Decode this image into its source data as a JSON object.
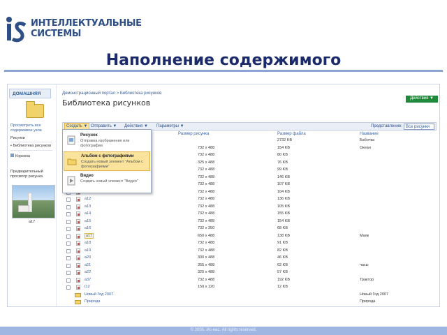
{
  "slide": {
    "logo_mark": "iS",
    "logo_line1": "ИНТЕЛЛЕКТУАЛЬНЫЕ",
    "logo_line2": "СИСТЕМЫ",
    "title": "Наполнение содержимого",
    "footer": "© 2005. Ис-нас. All rights reserved."
  },
  "nav": {
    "home_tab": "ДОМАШНЯЯ",
    "view_all": "Просмотреть все содержимое узла",
    "pictures_head": "Рисунки",
    "library_link": "• Библиотека рисунков",
    "recycle": "Корзина",
    "preview_label": "Предварительный просмотр рисунка",
    "preview_caption": "a17"
  },
  "main": {
    "breadcrumb": "Демонстрационный портал > Библиотека рисунков",
    "title": "Библиотека рисунков",
    "actions_button": "Действия ▼",
    "toolbar": {
      "create": "Создать ▼",
      "send": "Отправить ▼",
      "actions": "Действия ▼",
      "settings": "Параметры ▼",
      "view_label": "Представление:",
      "view_value": "Все рисунки"
    },
    "columns": {
      "size": "Размер рисунка",
      "filesize": "Размер файла",
      "name": "Название"
    }
  },
  "menu": {
    "items": [
      {
        "title": "Рисунок",
        "desc": "Отправка изображения или фотографии"
      },
      {
        "title": "Альбом с фотографиями",
        "desc": "Создать новый элемент \"Альбом с фотографиями\""
      },
      {
        "title": "Видео",
        "desc": "Создать новый элемент \"Видео\""
      }
    ]
  },
  "rows": [
    {
      "file": "",
      "size": "",
      "filesize": "2732 KB",
      "title": "Бабочка",
      "kind": "file"
    },
    {
      "file": "",
      "size": "732 x 488",
      "filesize": "154 KB",
      "title": "Океан",
      "kind": "file"
    },
    {
      "file": "",
      "size": "732 x 488",
      "filesize": "80 KB",
      "title": "",
      "kind": "file"
    },
    {
      "file": "",
      "size": "325 x 488",
      "filesize": "76 KB",
      "title": "",
      "kind": "file"
    },
    {
      "file": "",
      "size": "732 x 488",
      "filesize": "99 KB",
      "title": "",
      "kind": "file"
    },
    {
      "file": "",
      "size": "732 x 488",
      "filesize": "146 KB",
      "title": "",
      "kind": "file"
    },
    {
      "file": "",
      "size": "732 x 488",
      "filesize": "107 KB",
      "title": "",
      "kind": "file"
    },
    {
      "file": "",
      "size": "732 x 488",
      "filesize": "104 KB",
      "title": "",
      "kind": "file"
    },
    {
      "file": "a12",
      "size": "732 x 488",
      "filesize": "136 KB",
      "title": "",
      "kind": "file"
    },
    {
      "file": "a13",
      "size": "732 x 488",
      "filesize": "105 KB",
      "title": "",
      "kind": "file"
    },
    {
      "file": "a14",
      "size": "732 x 488",
      "filesize": "155 KB",
      "title": "",
      "kind": "file"
    },
    {
      "file": "a15",
      "size": "732 x 488",
      "filesize": "154 KB",
      "title": "",
      "kind": "file"
    },
    {
      "file": "a16",
      "size": "732 x 350",
      "filesize": "68 KB",
      "title": "",
      "kind": "file"
    },
    {
      "file": "a17",
      "size": "650 x 488",
      "filesize": "138 KB",
      "title": "Маяк",
      "kind": "file",
      "selected": true
    },
    {
      "file": "a18",
      "size": "732 x 488",
      "filesize": "91 KB",
      "title": "",
      "kind": "file"
    },
    {
      "file": "a19",
      "size": "732 x 488",
      "filesize": "82 KB",
      "title": "",
      "kind": "file"
    },
    {
      "file": "a20",
      "size": "300 x 488",
      "filesize": "46 KB",
      "title": "",
      "kind": "file"
    },
    {
      "file": "a21",
      "size": "355 x 488",
      "filesize": "62 KB",
      "title": "часы",
      "kind": "file"
    },
    {
      "file": "a22",
      "size": "325 x 488",
      "filesize": "57 KB",
      "title": "",
      "kind": "file"
    },
    {
      "file": "a37",
      "size": "732 x 488",
      "filesize": "192 KB",
      "title": "Трактор",
      "kind": "file"
    },
    {
      "file": "t12",
      "size": "150 x 120",
      "filesize": "12 KB",
      "title": "",
      "kind": "file"
    },
    {
      "file": "Новый Год 2007",
      "size": "",
      "filesize": "",
      "title": "Новый Год 2007",
      "kind": "folder"
    },
    {
      "file": "Природа",
      "size": "",
      "filesize": "",
      "title": "Природа",
      "kind": "folder"
    }
  ]
}
